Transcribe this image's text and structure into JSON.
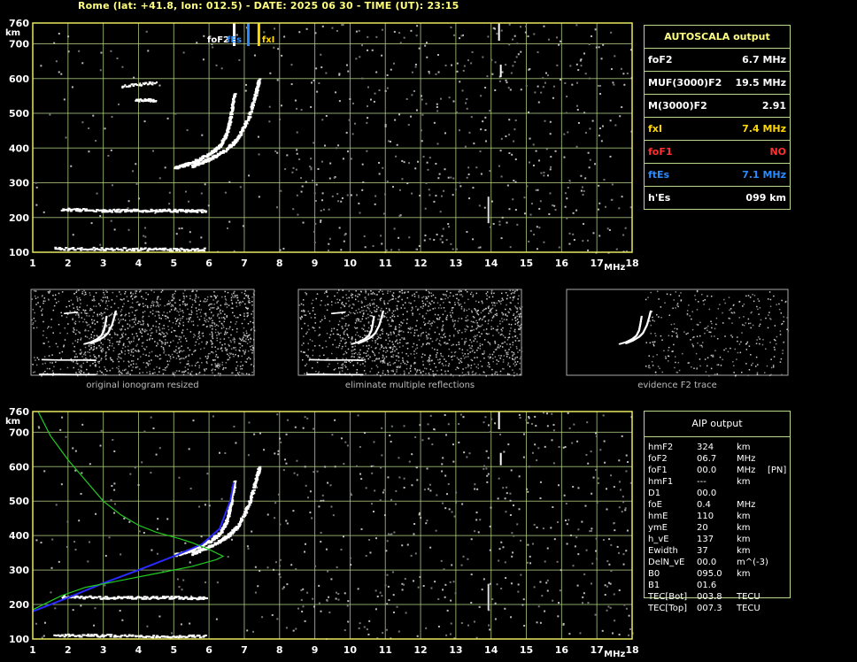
{
  "header": "Rome (lat: +41.8, lon: 012.5) - DATE: 2025 06 30 - TIME (UT): 23:15",
  "colors": {
    "grid": "#b8d88a",
    "frame": "#e8e860",
    "trace": "#ffffff",
    "model_profile": "#2a2aff",
    "green_curve": "#22cc22"
  },
  "chart_data": [
    {
      "type": "scatter",
      "title": "",
      "xlabel": "MHz",
      "ylabel": "km",
      "xlim": [
        1,
        18
      ],
      "ylim": [
        100,
        760
      ],
      "xticks": [
        1,
        2,
        3,
        4,
        5,
        6,
        7,
        8,
        9,
        10,
        11,
        12,
        13,
        14,
        15,
        16,
        17,
        18
      ],
      "yticks": [
        100,
        200,
        300,
        400,
        500,
        600,
        700,
        760
      ],
      "grid": true,
      "markers": [
        {
          "label": "foF2",
          "x": 6.7,
          "color": "#ffffff"
        },
        {
          "label": "fEs",
          "x": 7.1,
          "color": "#2a8cff"
        },
        {
          "label": "fxI",
          "x": 7.4,
          "color": "#ffd700"
        }
      ],
      "traces": {
        "F2_ordinary": [
          [
            5.0,
            345
          ],
          [
            5.5,
            360
          ],
          [
            6.0,
            385
          ],
          [
            6.3,
            410
          ],
          [
            6.5,
            450
          ],
          [
            6.6,
            500
          ],
          [
            6.7,
            560
          ]
        ],
        "F2_extraordinary": [
          [
            5.5,
            350
          ],
          [
            6.0,
            370
          ],
          [
            6.5,
            400
          ],
          [
            6.8,
            430
          ],
          [
            7.1,
            490
          ],
          [
            7.3,
            560
          ],
          [
            7.4,
            600
          ]
        ],
        "Es": [
          [
            1.8,
            225
          ],
          [
            3.0,
            222
          ],
          [
            4.0,
            222
          ],
          [
            5.0,
            222
          ],
          [
            5.9,
            220
          ]
        ],
        "Es_low": [
          [
            1.6,
            112
          ],
          [
            3.0,
            112
          ],
          [
            4.5,
            110
          ],
          [
            5.9,
            110
          ]
        ],
        "satellite": [
          [
            3.5,
            580
          ],
          [
            4.5,
            590
          ],
          [
            3.9,
            540
          ],
          [
            4.5,
            540
          ]
        ]
      }
    },
    {
      "type": "scatter",
      "title": "",
      "xlabel": "MHz",
      "ylabel": "km",
      "xlim": [
        1,
        18
      ],
      "ylim": [
        100,
        760
      ],
      "xticks": [
        1,
        2,
        3,
        4,
        5,
        6,
        7,
        8,
        9,
        10,
        11,
        12,
        13,
        14,
        15,
        16,
        17,
        18
      ],
      "yticks": [
        100,
        200,
        300,
        400,
        500,
        600,
        700,
        760
      ],
      "grid": true,
      "series": [
        {
          "name": "",
          "color": "#2a2aff",
          "points": [
            [
              1,
              180
            ],
            [
              2,
              220
            ],
            [
              3,
              262
            ],
            [
              4,
              300
            ],
            [
              5,
              340
            ],
            [
              5.8,
              375
            ],
            [
              6.3,
              420
            ],
            [
              6.6,
              500
            ],
            [
              6.7,
              555
            ]
          ]
        },
        {
          "name": "",
          "color": "#22cc22",
          "points": [
            [
              1.15,
              760
            ],
            [
              1.5,
              690
            ],
            [
              2,
              620
            ],
            [
              2.5,
              560
            ],
            [
              3,
              500
            ],
            [
              3.5,
              460
            ],
            [
              4,
              430
            ],
            [
              4.5,
              410
            ],
            [
              5.2,
              390
            ],
            [
              5.5,
              380
            ],
            [
              6.0,
              360
            ],
            [
              6.4,
              340
            ],
            [
              6.2,
              330
            ],
            [
              5.5,
              310
            ],
            [
              4.5,
              290
            ],
            [
              3.5,
              270
            ],
            [
              2.5,
              250
            ],
            [
              1.8,
              225
            ],
            [
              1,
              185
            ]
          ]
        }
      ]
    }
  ],
  "autoscala": {
    "title": "AUTOSCALA output",
    "rows": [
      {
        "k": "foF2",
        "v": "6.7 MHz",
        "kc": "#ffffff",
        "vc": "#ffffff"
      },
      {
        "k": "MUF(3000)F2",
        "v": "19.5 MHz",
        "kc": "#ffffff",
        "vc": "#ffffff"
      },
      {
        "k": "M(3000)F2",
        "v": "2.91",
        "kc": "#ffffff",
        "vc": "#ffffff"
      },
      {
        "k": "fxI",
        "v": "7.4 MHz",
        "kc": "#ffd700",
        "vc": "#ffd700"
      },
      {
        "k": "foF1",
        "v": "NO",
        "kc": "#ff3030",
        "vc": "#ff3030"
      },
      {
        "k": "ftEs",
        "v": "7.1 MHz",
        "kc": "#2a8cff",
        "vc": "#2a8cff"
      },
      {
        "k": "h'Es",
        "v": "099     km",
        "kc": "#ffffff",
        "vc": "#ffffff"
      }
    ]
  },
  "aip": {
    "title": "AIP output",
    "rows": [
      [
        "hmF2",
        "324",
        "km",
        ""
      ],
      [
        "foF2",
        "06.7",
        "MHz",
        ""
      ],
      [
        "foF1",
        "00.0",
        "MHz",
        "[PN]"
      ],
      [
        "hmF1",
        "---",
        "km",
        ""
      ],
      [
        "D1",
        "00.0",
        "",
        ""
      ],
      [
        "foE",
        "0.4",
        "MHz",
        ""
      ],
      [
        "hmE",
        "110",
        "km",
        ""
      ],
      [
        "ymE",
        "20",
        "km",
        ""
      ],
      [
        "h_vE",
        "137",
        "km",
        ""
      ],
      [
        "Ewidth",
        "37",
        "km",
        ""
      ],
      [
        "DelN_vE",
        "00.0",
        "m^(-3)",
        ""
      ],
      [
        "B0",
        "095.0",
        "km",
        ""
      ],
      [
        "B1",
        "01.6",
        "",
        ""
      ],
      [
        "TEC[Bot]",
        "003.8",
        "TECU",
        ""
      ],
      [
        "TEC[Top]",
        "007.3",
        "TECU",
        ""
      ]
    ]
  },
  "thumbs": [
    {
      "caption": "original ionogram resized"
    },
    {
      "caption": "eliminate multiple reflections"
    },
    {
      "caption": "evidence F2 trace"
    }
  ],
  "top_labels": {
    "foF2": "foF2",
    "fEs": "fEs",
    "fxI": "fxI",
    "km": "km",
    "mhz": "MHz"
  }
}
